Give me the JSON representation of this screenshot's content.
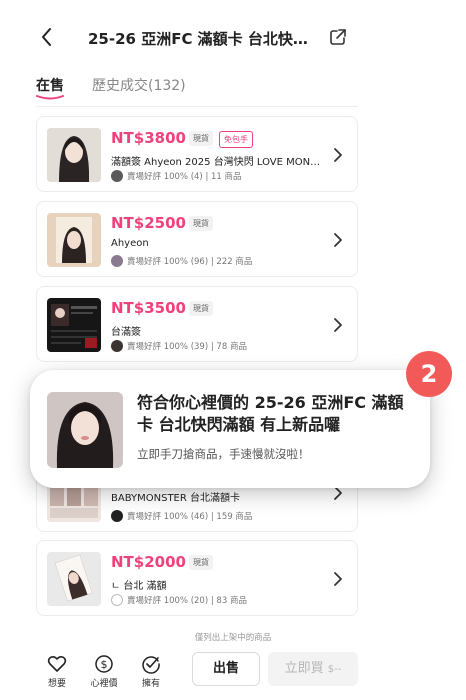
{
  "header": {
    "title": "25-26 亞洲FC 滿額卡 台北快閃…",
    "back_icon": "chevron-left-icon",
    "share_icon": "share-icon"
  },
  "tabs": {
    "active": "在售",
    "history": "歷史成交(132)"
  },
  "listings": [
    {
      "price": "NT$3800",
      "stock_tag": "現貨",
      "free_tag": "免包手",
      "name": "滿額簽 Ahyeon 2025 台灣快閃 LOVE MON…",
      "seller": "賣場好評 100% (4) | 11 商品"
    },
    {
      "price": "NT$2500",
      "stock_tag": "現貨",
      "name": "Ahyeon",
      "seller": "賣場好評 100% (96) | 222 商品"
    },
    {
      "price": "NT$3500",
      "stock_tag": "現貨",
      "name": "台滿簽",
      "seller": "賣場好評 100% (39) | 78 商品"
    },
    {
      "name": "BABYMONSTER 台北滿額卡",
      "seller": "賣場好評 100% (46) | 159 商品"
    },
    {
      "price": "NT$2000",
      "stock_tag": "現貨",
      "name": "ㄴ 台北 滿額",
      "seller": "賣場好評 100% (20) | 83 商品"
    }
  ],
  "toast": {
    "title": "符合你心裡價的 25-26 亞洲FC 滿額卡 台北快閃滿額 有上新品囉",
    "subtitle": "立即手刀搶商品，手速慢就沒啦！",
    "badge": "2"
  },
  "footer": {
    "note": "僅列出上架中的商品",
    "want": "想要",
    "price_alert": "心裡價",
    "owned": "擁有",
    "sell": "出售",
    "buy": "立即買",
    "buy_price": "$--"
  },
  "colors": {
    "accent": "#f0427a",
    "badge": "#f25a5a"
  }
}
